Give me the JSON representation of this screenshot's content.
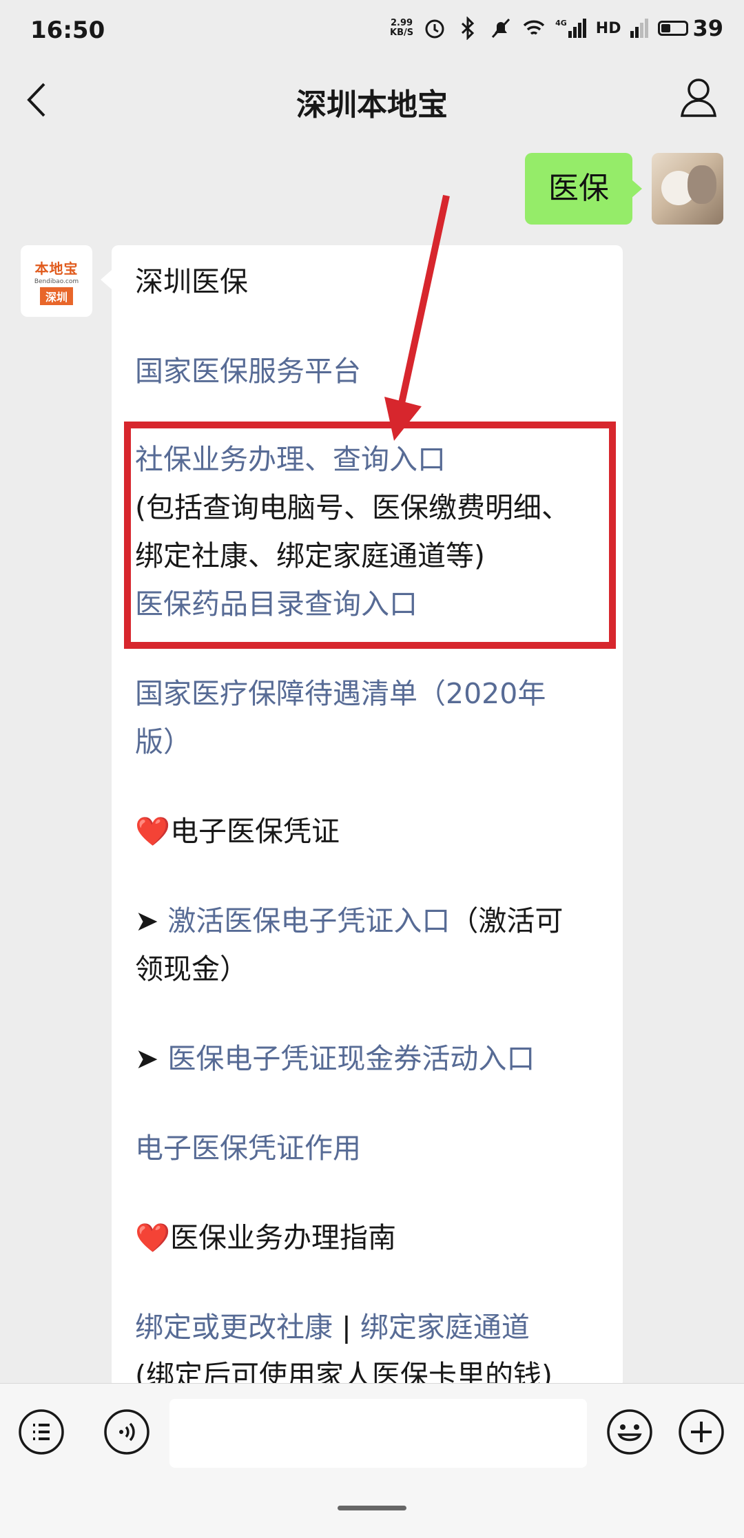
{
  "status_bar": {
    "time": "16:50",
    "net_speed_value": "2.99",
    "net_speed_unit": "KB/S",
    "network": "4G",
    "hd": "HD",
    "battery": "39",
    "battery_fraction": 0.39,
    "icons": [
      "alarm-icon",
      "bluetooth-icon",
      "mute-icon",
      "wifi-icon",
      "signal-icon",
      "signal-icon",
      "battery-icon"
    ]
  },
  "nav": {
    "title": "深圳本地宝",
    "back_icon": "back-arrow-icon",
    "profile_icon": "user-icon"
  },
  "outgoing": {
    "text": "医保",
    "bubble_color": "#95ec69"
  },
  "bot_avatar": {
    "logo_text": "本地宝",
    "logo_sub": "Bendibao.com",
    "logo_tag": "深圳",
    "brand_color": "#e8662a"
  },
  "reply": {
    "lines": [
      "深圳医保",
      "国家医保服务平台",
      "社保业务办理、查询入口",
      "(包括查询电脑号、医保缴费明细、",
      "绑定社康、绑定家庭通道等)",
      "医保药品目录查询入口",
      "国家医疗保障待遇清单（2020年",
      "版）",
      "❤️",
      "电子医保凭证",
      "➤ ",
      "激活医保电子凭证入口",
      "（激活可",
      "领现金）",
      "➤ ",
      "医保电子凭证现金券活动入口",
      "电子医保凭证作用",
      "❤️",
      "医保业务办理指南",
      "绑定或更改社康",
      " | ",
      "绑定家庭通道",
      "(绑定后可使用家人医保卡里的钱)"
    ],
    "link_color": "#576b95",
    "highlight_color": "#d7262d"
  },
  "input_bar": {
    "buttons": [
      "menu-icon",
      "voice-icon",
      "emoji-icon",
      "plus-icon"
    ],
    "field_value": ""
  }
}
